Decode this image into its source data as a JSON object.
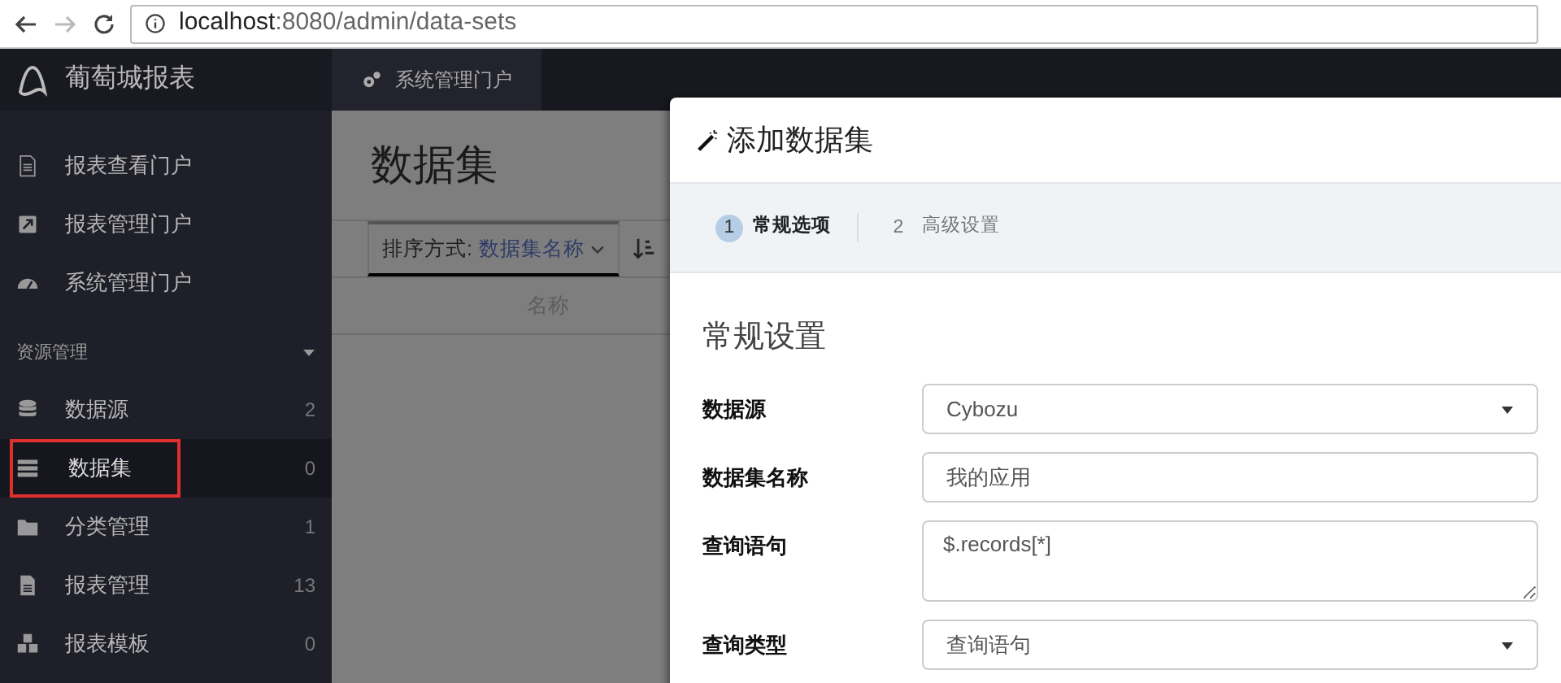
{
  "browser": {
    "url_host": "localhost",
    "url_rest": ":8080/admin/data-sets"
  },
  "brand": "葡萄城报表",
  "top_tabs": [
    {
      "label": "系统管理门户",
      "selected": true
    }
  ],
  "sidebar": {
    "portals": [
      {
        "label": "报表查看门户"
      },
      {
        "label": "报表管理门户"
      },
      {
        "label": "系统管理门户"
      }
    ],
    "section": {
      "label": "资源管理",
      "expanded": true
    },
    "items": [
      {
        "label": "数据源",
        "count": "2",
        "selected": false,
        "annotated": false
      },
      {
        "label": "数据集",
        "count": "0",
        "selected": true,
        "annotated": true
      },
      {
        "label": "分类管理",
        "count": "1",
        "selected": false,
        "annotated": false
      },
      {
        "label": "报表管理",
        "count": "13",
        "selected": false,
        "annotated": false
      },
      {
        "label": "报表模板",
        "count": "0",
        "selected": false,
        "annotated": false
      }
    ]
  },
  "page": {
    "title": "数据集",
    "sort_label": "排序方式:",
    "sort_value": "数据集名称",
    "columns": [
      "名称"
    ]
  },
  "modal": {
    "title": "添加数据集",
    "steps": [
      {
        "number": "1",
        "label": "常规选项",
        "selected": true
      },
      {
        "number": "2",
        "label": "高级设置",
        "selected": false
      }
    ],
    "section_title": "常规设置",
    "fields": [
      {
        "kind": "select",
        "label": "数据源",
        "value": "Cybozu"
      },
      {
        "kind": "input",
        "label": "数据集名称",
        "value": "我的应用"
      },
      {
        "kind": "textarea",
        "label": "查询语句",
        "value": "$.records[*]"
      },
      {
        "kind": "select",
        "label": "查询类型",
        "value": "查询语句"
      }
    ]
  }
}
